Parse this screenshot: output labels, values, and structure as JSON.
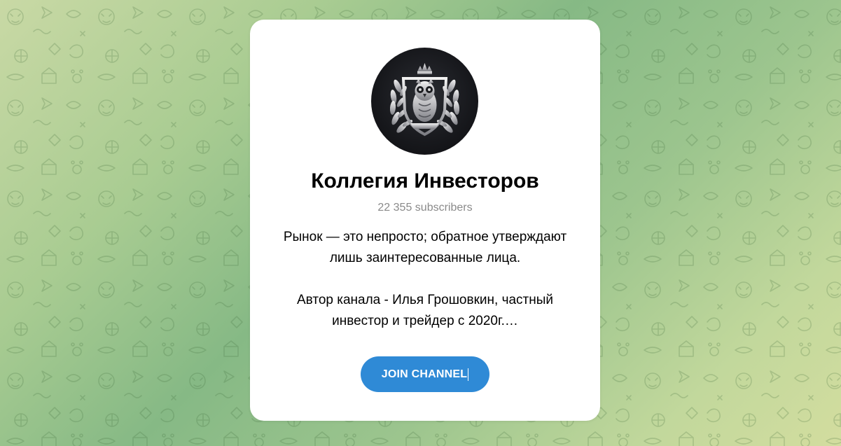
{
  "channel": {
    "title": "Коллегия Инвесторов",
    "subscribers": "22 355 subscribers",
    "description_line1": "Рынок — это непросто; обратное утверждают",
    "description_line2": "лишь заинтересованные лица.",
    "description_line3": "Автор канала - Илья Грошовкин, частный",
    "description_line4": "инвестор и трейдер с 2020г.…",
    "avatar_icon": "owl-crest-icon"
  },
  "actions": {
    "join_label": "JOIN CHANNEL"
  },
  "colors": {
    "accent": "#2f8ad6",
    "card": "#ffffff",
    "muted_text": "#8a8a8a",
    "background_green": "#86b985"
  }
}
